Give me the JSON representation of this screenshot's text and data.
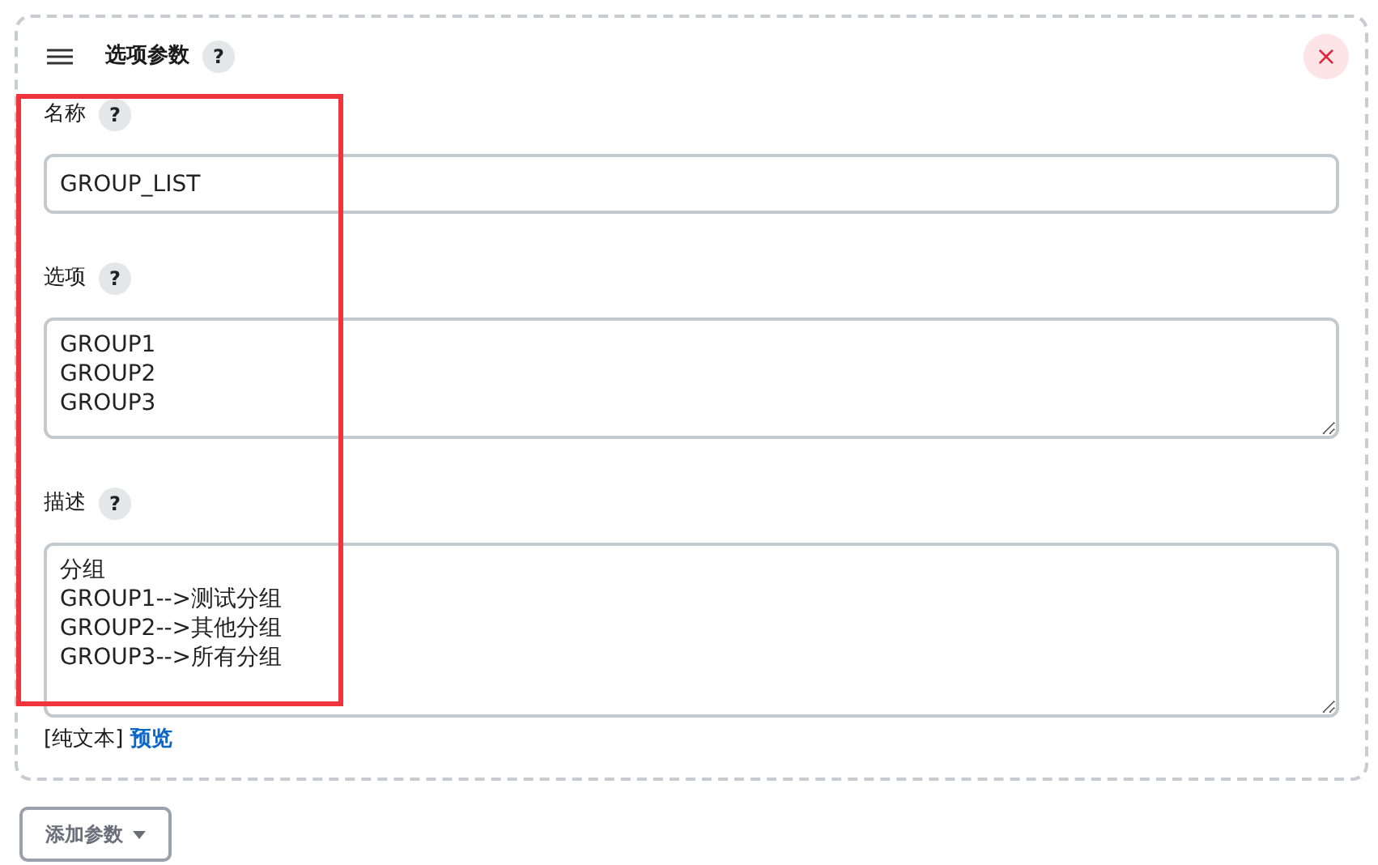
{
  "panel": {
    "title": "选项参数",
    "help": "?",
    "close": "×",
    "fields": [
      {
        "kind": "input",
        "label": "名称",
        "help": "?",
        "value": "GROUP_LIST"
      },
      {
        "kind": "textarea",
        "label": "选项",
        "help": "?",
        "value": "GROUP1\nGROUP2\nGROUP3"
      },
      {
        "kind": "textarea",
        "label": "描述",
        "help": "?",
        "value": "分组\nGROUP1-->测试分组\nGROUP2-->其他分组\nGROUP3-->所有分组"
      }
    ],
    "format_note": "[纯文本]",
    "preview_link": "预览"
  },
  "add_button": "添加参数"
}
